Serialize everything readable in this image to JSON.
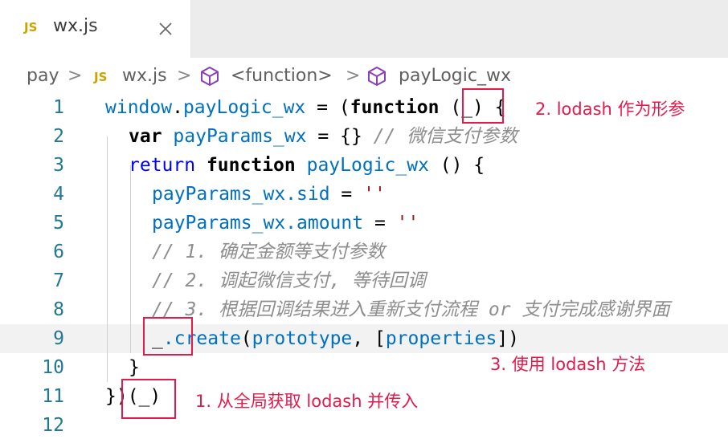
{
  "tab": {
    "badge": "JS",
    "filename": "wx.js"
  },
  "breadcrumb": {
    "folder": "pay",
    "badge": "JS",
    "file": "wx.js",
    "symbol1": "<function>",
    "symbol2": "payLogic_wx",
    "separator": ">"
  },
  "code": {
    "line_numbers": [
      "1",
      "2",
      "3",
      "4",
      "5",
      "6",
      "7",
      "8",
      "9",
      "10",
      "11",
      "12"
    ],
    "l1": {
      "obj": "window",
      "dot": ".",
      "prop": "payLogic_wx",
      "eq": " = (",
      "kw": "function",
      "sp": " ",
      "param": "(_)",
      "brace": " {"
    },
    "l2": {
      "kw": "var",
      "id": "payParams_wx",
      "rest": " = {}",
      "comment": "// 微信支付参数"
    },
    "l3": {
      "kw": "return",
      "kw2": "function",
      "name": "payLogic_wx",
      "rest": " () {"
    },
    "l4": {
      "obj": "payParams_wx",
      "prop": ".sid",
      "eq": " = ",
      "str": "''"
    },
    "l5": {
      "obj": "payParams_wx",
      "prop": ".amount",
      "eq": " = ",
      "str": "''"
    },
    "l6": {
      "comment": "// 1. 确定金额等支付参数"
    },
    "l7": {
      "comment": "// 2. 调起微信支付, 等待回调"
    },
    "l8": {
      "comment": "// 3. 根据回调结果进入重新支付流程 or 支付完成感谢界面"
    },
    "l9": {
      "underscore": "_",
      "method": ".create",
      "open": "(",
      "arg1": "prototype",
      "comma": ", [",
      "arg2": "properties",
      "close": "])"
    },
    "l10": {
      "brace": "}"
    },
    "l11": {
      "close": "})",
      "call": "(_)"
    }
  },
  "annotations": {
    "a1": "1. 从全局获取 lodash 并传入",
    "a2": "2. lodash 作为形参",
    "a3": "3. 使用 lodash 方法"
  },
  "colors": {
    "annotation": "#e6194b",
    "line_number": "#237893",
    "js_badge": "#c9a400"
  }
}
